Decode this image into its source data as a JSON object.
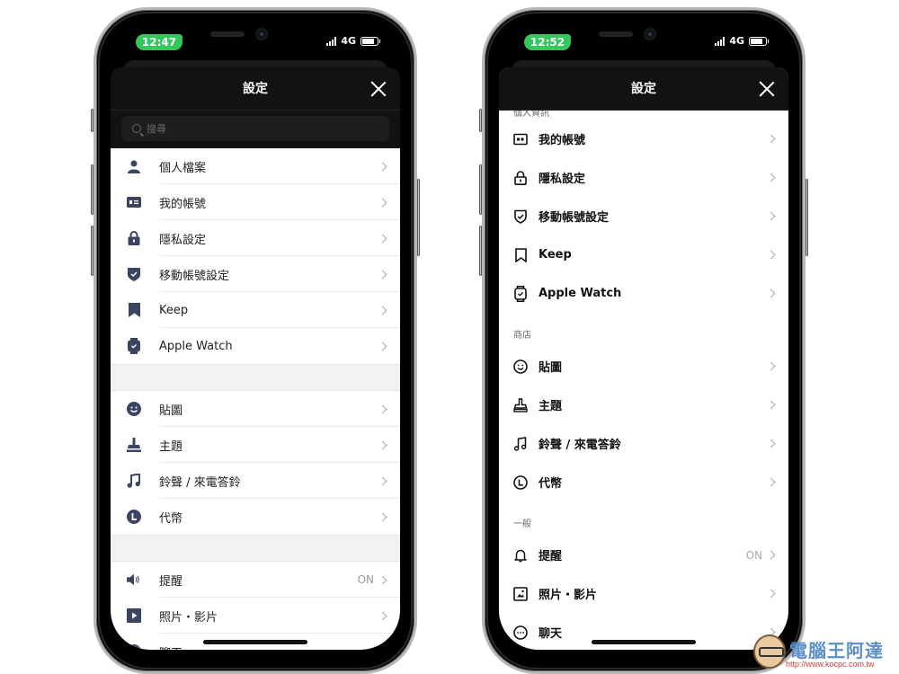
{
  "left_phone": {
    "status": {
      "time": "12:47",
      "network": "4G"
    },
    "header": {
      "title": "設定",
      "close_icon": "close-icon"
    },
    "search": {
      "placeholder": "搜尋"
    },
    "groups": [
      [
        {
          "label": "個人檔案",
          "icon": "person-icon"
        },
        {
          "label": "我的帳號",
          "icon": "id-card-icon"
        },
        {
          "label": "隱私設定",
          "icon": "lock-icon"
        },
        {
          "label": "移動帳號設定",
          "icon": "shield-check-icon"
        },
        {
          "label": "Keep",
          "icon": "bookmark-icon"
        },
        {
          "label": "Apple Watch",
          "icon": "watch-icon"
        }
      ],
      [
        {
          "label": "貼圖",
          "icon": "smiley-icon"
        },
        {
          "label": "主題",
          "icon": "brush-icon"
        },
        {
          "label": "鈴聲 / 來電答鈴",
          "icon": "music-note-icon"
        },
        {
          "label": "代幣",
          "icon": "coin-icon"
        }
      ],
      [
        {
          "label": "提醒",
          "icon": "speaker-icon",
          "value": "ON"
        },
        {
          "label": "照片・影片",
          "icon": "play-icon"
        },
        {
          "label": "聊天",
          "icon": "chat-icon"
        }
      ]
    ]
  },
  "right_phone": {
    "status": {
      "time": "12:52",
      "network": "4G"
    },
    "header": {
      "title": "設定",
      "close_icon": "close-icon"
    },
    "sections": [
      {
        "title": "個人資訊",
        "items": [
          {
            "label": "我的帳號",
            "icon": "id-card-icon"
          },
          {
            "label": "隱私設定",
            "icon": "lock-icon"
          },
          {
            "label": "移動帳號設定",
            "icon": "shield-check-icon"
          },
          {
            "label": "Keep",
            "icon": "bookmark-icon"
          },
          {
            "label": "Apple Watch",
            "icon": "watch-icon"
          }
        ]
      },
      {
        "title": "商店",
        "items": [
          {
            "label": "貼圖",
            "icon": "smiley-icon"
          },
          {
            "label": "主題",
            "icon": "brush-icon"
          },
          {
            "label": "鈴聲 / 來電答鈴",
            "icon": "music-note-icon"
          },
          {
            "label": "代幣",
            "icon": "coin-icon"
          }
        ]
      },
      {
        "title": "一般",
        "items": [
          {
            "label": "提醒",
            "icon": "bell-icon",
            "value": "ON"
          },
          {
            "label": "照片・影片",
            "icon": "photo-icon"
          },
          {
            "label": "聊天",
            "icon": "chat-icon"
          }
        ]
      }
    ]
  },
  "watermark": {
    "title": "電腦王阿達",
    "url": "http://www.kocpc.com.tw"
  },
  "colors": {
    "icon_navy": "#3b4461",
    "time_pill": "#34c759",
    "header_dark": "#121212"
  }
}
